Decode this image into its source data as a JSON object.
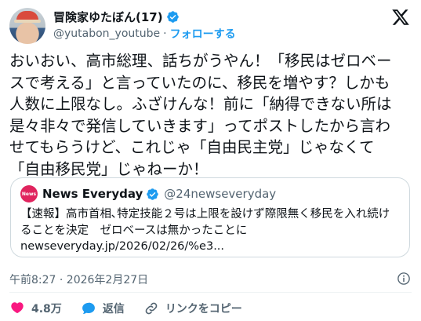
{
  "author": {
    "display_name": "冒険家ゆたぼん(17)",
    "handle": "@yutabon_youtube",
    "separator": "·",
    "follow_label": "フォローする"
  },
  "tweet": {
    "text": "おいおい、高市総理、話ちがうやん！「移民はゼロベー\nスで考える」と言っていたのに、移民を増やす？しかも\n人数に上限なし。ふざけんな！前に「納得できない所は\n是々非々で発信していきます」ってポストしたから言わ\nせてもらうけど、これじゃ「自由民主党」じゃなくて\n「自由移民党」じゃねーか！"
  },
  "quoted": {
    "logo_text": "News",
    "name": "News Everyday",
    "handle": "@24newseveryday",
    "text": "【速報】高市首相､特定技能２号は上限を設けず際限無く移民を入れ続け\nることを決定　ゼロベースは無かったことに",
    "link": "newseveryday.jp/2026/02/26/%e3..."
  },
  "meta": {
    "timestamp": "午前8:27 · 2026年2月27日"
  },
  "actions": {
    "like_count": "4.8万",
    "reply_label": "返信",
    "copy_link_label": "リンクをコピー"
  },
  "colors": {
    "accent": "#1d9bf0",
    "like": "#f91880",
    "muted": "#536471",
    "news_brand": "#e0245e"
  },
  "icons": {
    "verified": "verified-badge-icon",
    "x_logo": "x-logo-icon",
    "info": "info-icon",
    "like": "heart-icon",
    "reply": "reply-bubble-icon",
    "link": "link-icon"
  }
}
